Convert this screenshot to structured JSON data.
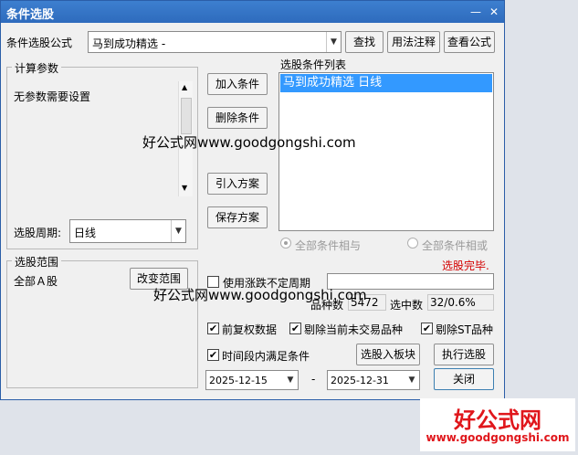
{
  "window": {
    "title": "条件选股",
    "close_glyph": "✕"
  },
  "formula": {
    "label": "条件选股公式",
    "value": "马到成功精选  -",
    "find": "查找",
    "usage": "用法注释",
    "view": "查看公式"
  },
  "params": {
    "group": "计算参数",
    "text": "无参数需要设置"
  },
  "period": {
    "label": "选股周期:",
    "value": "日线"
  },
  "range": {
    "group": "选股范围",
    "value": "全部Ａ股",
    "change": "改变范围"
  },
  "actions": {
    "add": "加入条件",
    "delete": "删除条件",
    "import": "引入方案",
    "save": "保存方案"
  },
  "conditions": {
    "label": "选股条件列表",
    "items": [
      "马到成功精选  日线"
    ]
  },
  "logic": {
    "and": "全部条件相与",
    "or": "全部条件相或"
  },
  "status": {
    "text": "选股完毕.",
    "color": "#d40000"
  },
  "indeterminate": {
    "label": "使用涨跌不定周期"
  },
  "stats": {
    "count_label": "品种数",
    "count": "5472",
    "hit_label": "选中数",
    "hit": "32/0.6%"
  },
  "options": {
    "prev_adj": "前复权数据",
    "exclude_halt": "剔除当前未交易品种",
    "exclude_st": "剔除ST品种",
    "time_range": "时间段内满足条件"
  },
  "dates": {
    "start": "2025-12-15",
    "sep": "-",
    "end": "2025-12-31"
  },
  "buttons": {
    "to_block": "选股入板块",
    "run": "执行选股",
    "close": "关闭"
  },
  "watermark": {
    "text": "好公式网www.goodgongshi.com",
    "logo": "好公式网",
    "url": "www.goodgongshi.com"
  }
}
